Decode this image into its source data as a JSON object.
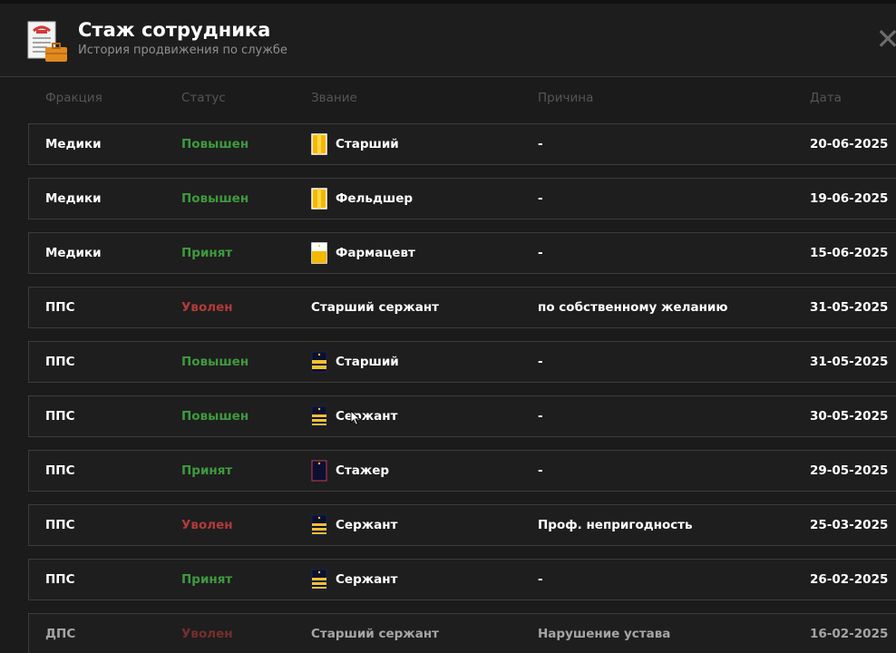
{
  "header": {
    "title": "Стаж сотрудника",
    "subtitle": "История продвижения по службе",
    "icon": "document-briefcase-icon",
    "close_icon": "close-icon"
  },
  "columns": [
    "Фракция",
    "Статус",
    "Звание",
    "Причина",
    "Дата"
  ],
  "colors": {
    "status_positive": "#3e9a3e",
    "status_fired": "#b13a3a",
    "medic_badge": "#f5b800",
    "police_badge": "#f2c12e"
  },
  "rows": [
    {
      "faction": "Медики",
      "status": "Повышен",
      "status_type": "up",
      "rank": "Старший",
      "badge": "medic-stripe",
      "reason": "-",
      "date": "20-06-2025"
    },
    {
      "faction": "Медики",
      "status": "Повышен",
      "status_type": "up",
      "rank": "Фельдшер",
      "badge": "medic-stripe",
      "reason": "-",
      "date": "19-06-2025"
    },
    {
      "faction": "Медики",
      "status": "Принят",
      "status_type": "accepted",
      "rank": "Фармацевт",
      "badge": "medic-half",
      "reason": "-",
      "date": "15-06-2025"
    },
    {
      "faction": "ППС",
      "status": "Уволен",
      "status_type": "fired",
      "rank": "Старший сержант",
      "badge": "none",
      "reason": "по собственному желанию",
      "date": "31-05-2025"
    },
    {
      "faction": "ППС",
      "status": "Повышен",
      "status_type": "up",
      "rank": "Старший",
      "badge": "police-stripes",
      "reason": "-",
      "date": "31-05-2025"
    },
    {
      "faction": "ППС",
      "status": "Повышен",
      "status_type": "up",
      "rank": "Сержант",
      "badge": "police-stripes",
      "reason": "-",
      "date": "30-05-2025"
    },
    {
      "faction": "ППС",
      "status": "Принят",
      "status_type": "accepted",
      "rank": "Стажер",
      "badge": "police-empty",
      "reason": "-",
      "date": "29-05-2025"
    },
    {
      "faction": "ППС",
      "status": "Уволен",
      "status_type": "fired",
      "rank": "Сержант",
      "badge": "police-stripes",
      "reason": "Проф. непригодность",
      "date": "25-03-2025"
    },
    {
      "faction": "ППС",
      "status": "Принят",
      "status_type": "accepted",
      "rank": "Сержант",
      "badge": "police-stripes",
      "reason": "-",
      "date": "26-02-2025"
    },
    {
      "faction": "ДПС",
      "status": "Уволен",
      "status_type": "fired",
      "rank": "Старший сержант",
      "badge": "none",
      "reason": "Нарушение устава",
      "date": "16-02-2025"
    }
  ]
}
